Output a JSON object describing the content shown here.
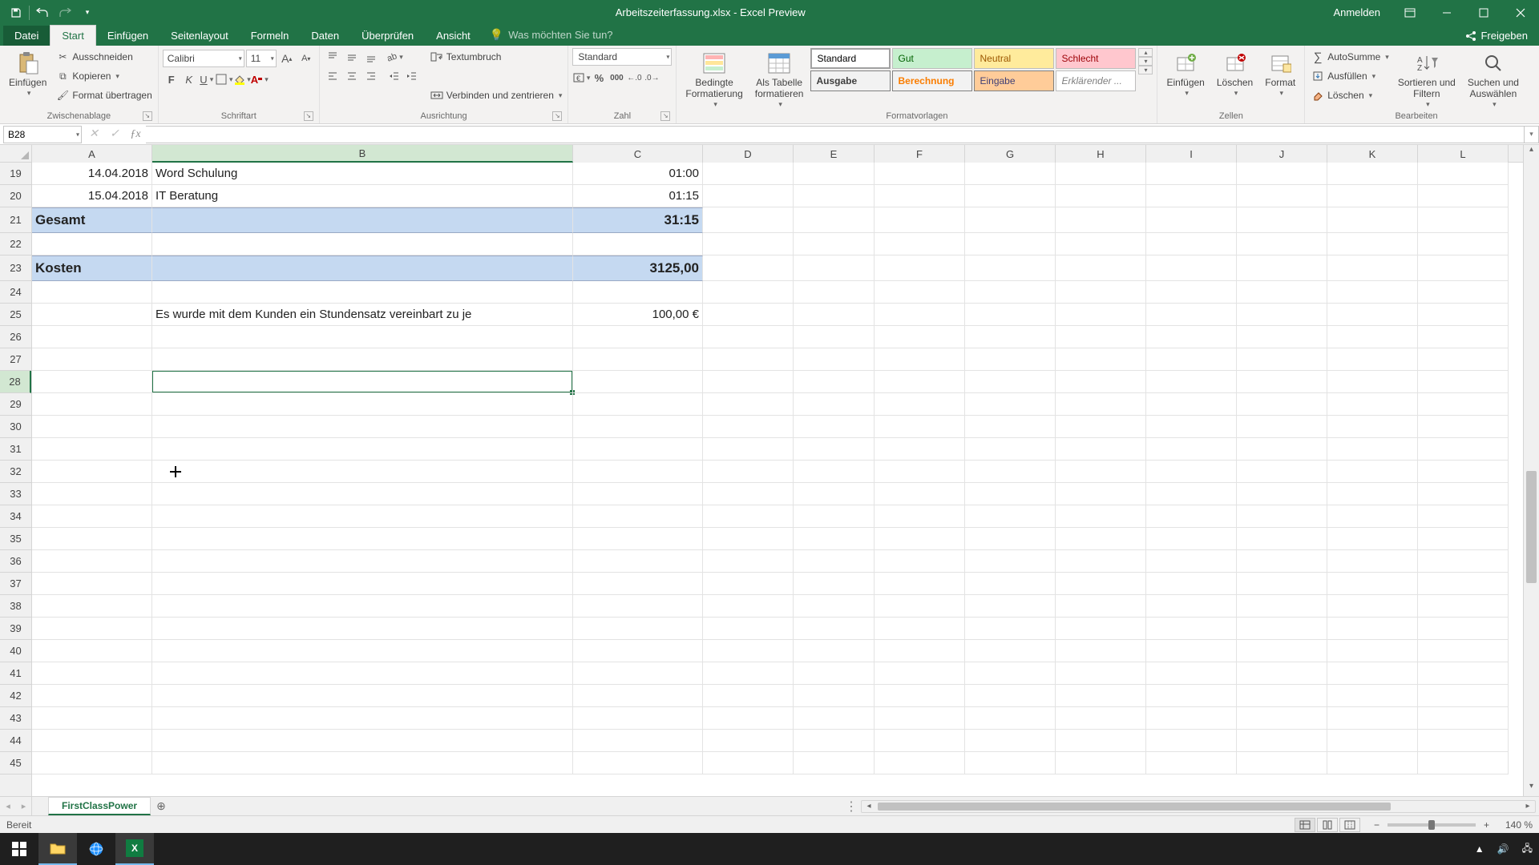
{
  "title": "Arbeitszeiterfassung.xlsx - Excel Preview",
  "login": "Anmelden",
  "tabs": {
    "file": "Datei",
    "start": "Start",
    "einfuegen": "Einfügen",
    "seitenlayout": "Seitenlayout",
    "formeln": "Formeln",
    "daten": "Daten",
    "ueberpruefen": "Überprüfen",
    "ansicht": "Ansicht",
    "tellme": "Was möchten Sie tun?",
    "share": "Freigeben"
  },
  "ribbon": {
    "clipboard": {
      "label": "Zwischenablage",
      "paste": "Einfügen",
      "cut": "Ausschneiden",
      "copy": "Kopieren",
      "format_painter": "Format übertragen"
    },
    "font": {
      "label": "Schriftart",
      "name": "Calibri",
      "size": "11"
    },
    "alignment": {
      "label": "Ausrichtung",
      "wrap": "Textumbruch",
      "merge": "Verbinden und zentrieren"
    },
    "number": {
      "label": "Zahl",
      "fmt": "Standard"
    },
    "styles": {
      "label": "Formatvorlagen",
      "cond": "Bedingte\nFormatierung",
      "table": "Als Tabelle\nformatieren",
      "standard": "Standard",
      "gut": "Gut",
      "neutral": "Neutral",
      "schlecht": "Schlecht",
      "ausgabe": "Ausgabe",
      "berechnung": "Berechnung",
      "eingabe": "Eingabe",
      "erkl": "Erklärender ..."
    },
    "cells": {
      "label": "Zellen",
      "insert": "Einfügen",
      "delete": "Löschen",
      "format": "Format"
    },
    "editing": {
      "label": "Bearbeiten",
      "autosum": "AutoSumme",
      "fill": "Ausfüllen",
      "clear": "Löschen",
      "sort": "Sortieren und\nFiltern",
      "find": "Suchen und\nAuswählen"
    }
  },
  "namebox": "B28",
  "columns": [
    "A",
    "B",
    "C",
    "D",
    "E",
    "F",
    "G",
    "H",
    "I",
    "J",
    "K",
    "L"
  ],
  "rows_start": 19,
  "rows_end": 45,
  "cells": {
    "A19": "14.04.2018",
    "B19": "Word Schulung",
    "C19": "01:00",
    "A20": "15.04.2018",
    "B20": "IT Beratung",
    "C20": "01:15",
    "A21": "Gesamt",
    "C21": "31:15",
    "A23": "Kosten",
    "C23": "3125,00",
    "B25": "Es wurde mit dem Kunden ein Stundensatz vereinbart zu je",
    "C25": "100,00 €"
  },
  "active_cell": "B28",
  "sheet_tab": "FirstClassPower",
  "status": "Bereit",
  "zoom": "140 %",
  "tray": {
    "chevron": "▲",
    "speaker": "🔊",
    "net": "🖧"
  }
}
